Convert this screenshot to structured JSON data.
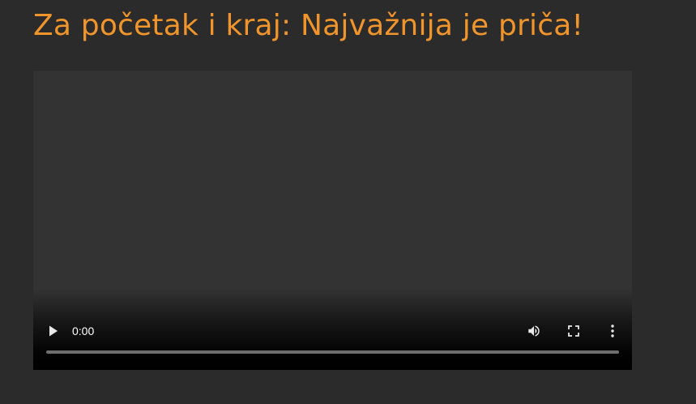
{
  "page": {
    "title": "Za početak i kraj: Najvažnija je priča!"
  },
  "player": {
    "current_time": "0:00",
    "progress": 0,
    "icons": {
      "play": "play-icon",
      "volume": "volume-icon",
      "fullscreen": "fullscreen-icon",
      "more": "more-vert-icon"
    },
    "colors": {
      "title": "#f0952b",
      "background": "#2b2b2b",
      "player_bg": "#333333",
      "controls_fg": "#ffffff"
    }
  }
}
